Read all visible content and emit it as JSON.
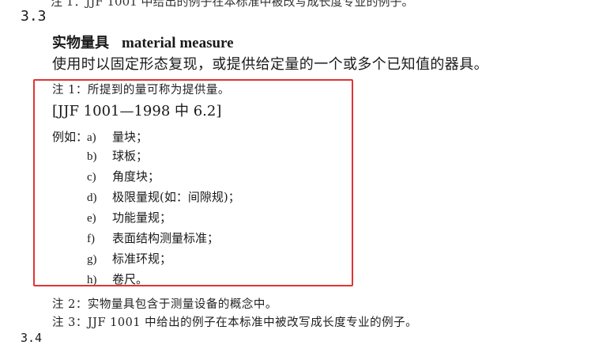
{
  "top_cut_text": "注 1：JJF 1001 中给出的例子在本标准中被改写成长度专业的例子。",
  "section": {
    "number": "3.3",
    "term_zh": "实物量具",
    "term_en": "material measure",
    "definition": "使用时以固定形态复现，或提供给定量的一个或多个已知值的器具。"
  },
  "notes": {
    "note1": "注 1：所提到的量可称为提供量。",
    "reference": "[JJF 1001—1998 中 6.2]",
    "examples_label": "例如：",
    "examples": [
      {
        "mark": "a)",
        "text": "量块；"
      },
      {
        "mark": "b)",
        "text": "球板；"
      },
      {
        "mark": "c)",
        "text": "角度块；"
      },
      {
        "mark": "d)",
        "text": "极限量规(如：间隙规)；"
      },
      {
        "mark": "e)",
        "text": "功能量规；"
      },
      {
        "mark": "f)",
        "text": "表面结构测量标准；"
      },
      {
        "mark": "g)",
        "text": "标准环规；"
      },
      {
        "mark": "h)",
        "text": "卷尺。"
      }
    ],
    "note2": "注 2：实物量具包含于测量设备的概念中。",
    "note3": "注 3：JJF 1001 中给出的例子在本标准中被改写成长度专业的例子。"
  },
  "bottom_cut_text": "3.4",
  "highlight_color": "#e03434"
}
